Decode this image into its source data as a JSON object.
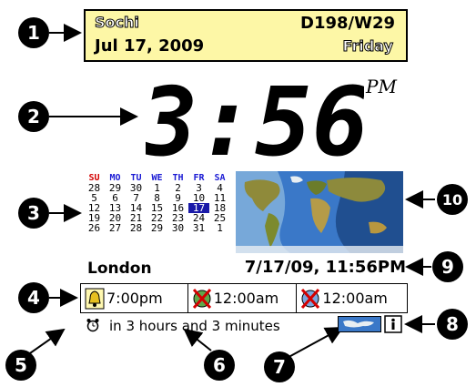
{
  "callouts": [
    "1",
    "2",
    "3",
    "4",
    "5",
    "6",
    "7",
    "8",
    "9",
    "10"
  ],
  "banner": {
    "city": "Sochi",
    "day_week": "D198/W29",
    "date": "Jul 17, 2009",
    "weekday": "Friday"
  },
  "clock": {
    "time": "3:56",
    "ampm": "PM"
  },
  "calendar": {
    "headers": [
      "SU",
      "MO",
      "TU",
      "WE",
      "TH",
      "FR",
      "SA"
    ],
    "rows": [
      [
        "28",
        "29",
        "30",
        "1",
        "2",
        "3",
        "4"
      ],
      [
        "5",
        "6",
        "7",
        "8",
        "9",
        "10",
        "11"
      ],
      [
        "12",
        "13",
        "14",
        "15",
        "16",
        "17",
        "18"
      ],
      [
        "19",
        "20",
        "21",
        "22",
        "23",
        "24",
        "25"
      ],
      [
        "26",
        "27",
        "28",
        "29",
        "30",
        "31",
        "1"
      ]
    ],
    "today": "17"
  },
  "world_clock": {
    "location": "London",
    "datetime": "7/17/09, 11:56PM"
  },
  "alarms": [
    {
      "icon": "bell-icon",
      "time": "7:00pm"
    },
    {
      "icon": "disabled-alarm-icon",
      "time": "12:00am"
    },
    {
      "icon": "disabled-alarm-icon",
      "time": "12:00am"
    }
  ],
  "status": {
    "icon": "alarm-clock-icon",
    "next_alarm": "in 3 hours and 3 minutes"
  },
  "buttons": {
    "map_toggle": "map-toggle-icon",
    "info": "info-icon"
  },
  "colors": {
    "banner_bg": "#fdf7a6",
    "calendar_header": "#1a1ad4",
    "sunday": "#d40000",
    "today_bg": "#1a1aa8",
    "ocean": "#3a78c8"
  }
}
